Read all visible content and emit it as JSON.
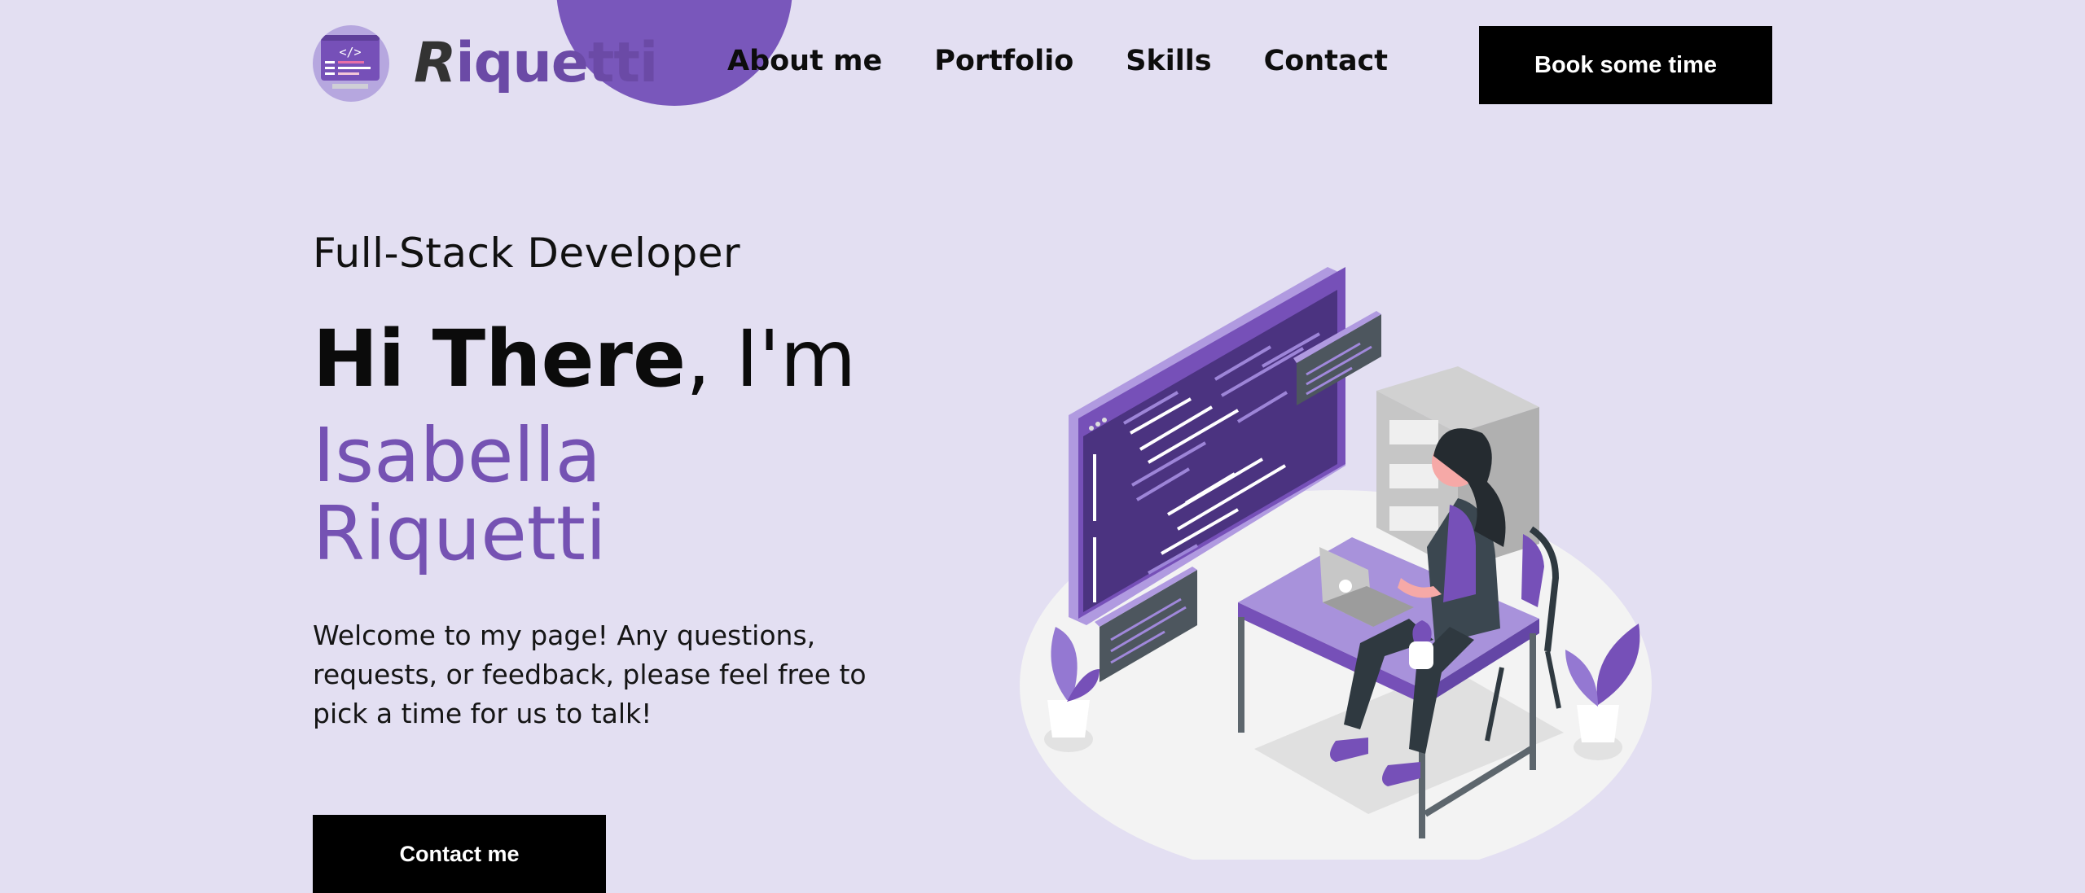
{
  "header": {
    "logo_text_first": "R",
    "logo_text_rest": "iquetti",
    "nav": [
      "About me",
      "Portfolio",
      "Skills",
      "Contact"
    ],
    "cta_label": "Book some time"
  },
  "hero": {
    "subtitle": "Full-Stack Developer",
    "greeting_bold": "Hi There",
    "greeting_rest": ", I'm",
    "name_first": "Isabella",
    "name_last": "Riquetti",
    "intro": "Welcome to my page! Any questions, requests, or feedback, please feel free to pick a time for us to talk!",
    "cta_label": "Contact me"
  },
  "logo_badge_glyph": "</>",
  "colors": {
    "background": "#e3dff2",
    "accent": "#7552b3",
    "button": "#000000",
    "blob": "#7957bb"
  },
  "icons": {
    "logo": "code-window-icon",
    "illustration": "developer-at-desk-illustration"
  }
}
